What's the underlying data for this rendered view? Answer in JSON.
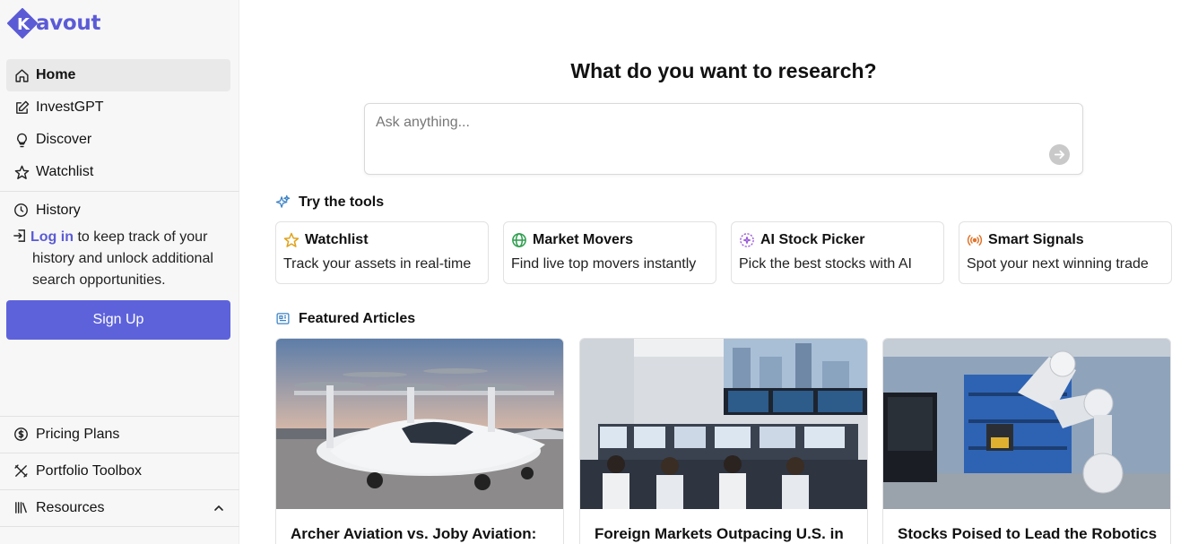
{
  "brand": {
    "name": "avout",
    "logo_letter": "K",
    "color": "#5b5bd6"
  },
  "nav": [
    {
      "label": "Home",
      "icon": "home-icon",
      "active": true
    },
    {
      "label": "InvestGPT",
      "icon": "edit-icon",
      "active": false
    },
    {
      "label": "Discover",
      "icon": "lightbulb-icon",
      "active": false
    },
    {
      "label": "Watchlist",
      "icon": "star-icon",
      "active": false
    }
  ],
  "history": {
    "label": "History",
    "icon": "clock-icon"
  },
  "login_prompt": {
    "link": "Log in",
    "text_a": "to keep track of your",
    "text_b": "history and unlock additional",
    "text_c": "search opportunities."
  },
  "signup_label": "Sign Up",
  "bottom_nav": [
    {
      "label": "Pricing Plans",
      "icon": "dollar-circle-icon"
    },
    {
      "label": "Portfolio Toolbox",
      "icon": "tools-icon"
    },
    {
      "label": "Resources",
      "icon": "library-icon"
    }
  ],
  "main": {
    "title": "What do you want to research?",
    "search_placeholder": "Ask anything...",
    "tools_heading": "Try the tools",
    "articles_heading": "Featured Articles"
  },
  "tools": [
    {
      "title": "Watchlist",
      "desc": "Track your assets in real-time",
      "icon": "star-icon",
      "color": "#e0a21b"
    },
    {
      "title": "Market Movers",
      "desc": "Find live top movers instantly",
      "icon": "globe-icon",
      "color": "#2e9e4f"
    },
    {
      "title": "AI Stock Picker",
      "desc": "Pick the best stocks with AI",
      "icon": "ai-picker-icon",
      "color": "#9b5bd6"
    },
    {
      "title": "Smart Signals",
      "desc": "Spot your next winning trade",
      "icon": "signal-icon",
      "color": "#e0742b"
    }
  ],
  "articles": [
    {
      "title": "Archer Aviation vs. Joby Aviation:"
    },
    {
      "title": "Foreign Markets Outpacing U.S. in"
    },
    {
      "title": "Stocks Poised to Lead the Robotics"
    }
  ]
}
